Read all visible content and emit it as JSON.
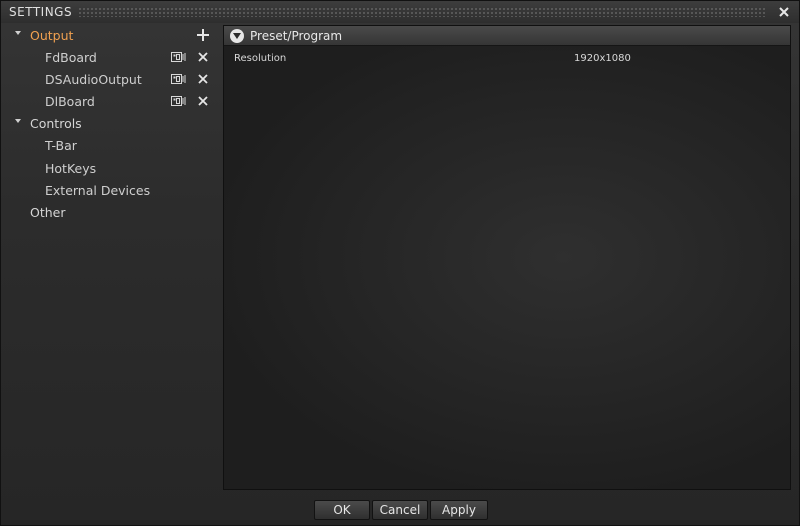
{
  "window": {
    "title": "SETTINGS"
  },
  "sidebar": {
    "output": {
      "label": "Output",
      "items": [
        {
          "label": "FdBoard"
        },
        {
          "label": "DSAudioOutput"
        },
        {
          "label": "DlBoard"
        }
      ]
    },
    "controls": {
      "label": "Controls",
      "items": [
        {
          "label": "T-Bar"
        },
        {
          "label": "HotKeys"
        },
        {
          "label": "External Devices"
        }
      ]
    },
    "other": {
      "label": "Other"
    }
  },
  "panel": {
    "header": "Preset/Program",
    "properties": [
      {
        "name": "Resolution",
        "value": "1920x1080"
      }
    ]
  },
  "buttons": {
    "ok": "OK",
    "cancel": "Cancel",
    "apply": "Apply"
  },
  "colors": {
    "accent": "#f0a050",
    "background": "#2b2b2b",
    "panel": "#1e1e1e"
  }
}
